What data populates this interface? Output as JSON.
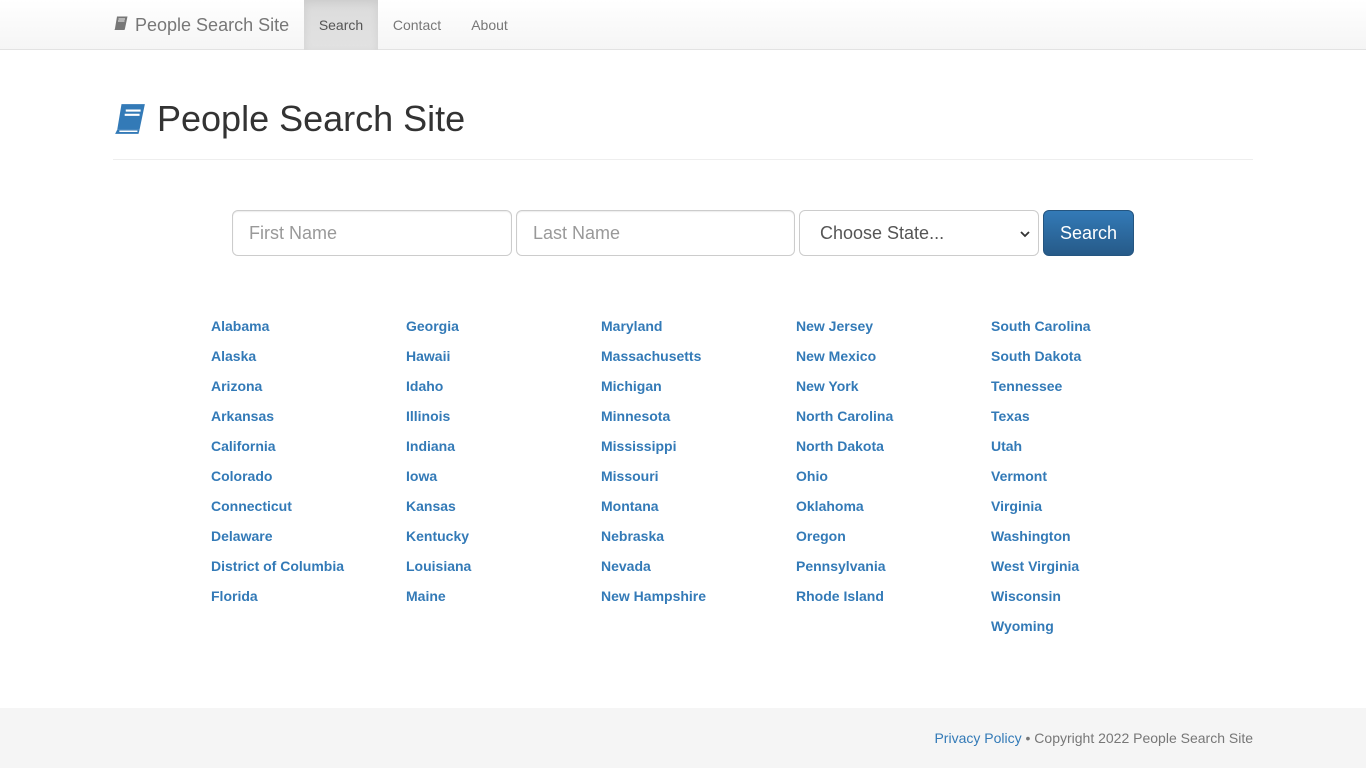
{
  "navbar": {
    "brand": "People Search Site",
    "items": [
      {
        "label": "Search",
        "active": true
      },
      {
        "label": "Contact",
        "active": false
      },
      {
        "label": "About",
        "active": false
      }
    ]
  },
  "header": {
    "title": "People Search Site",
    "icon": "book-icon"
  },
  "search_form": {
    "first_name_placeholder": "First Name",
    "last_name_placeholder": "Last Name",
    "state_select_value": "Choose State...",
    "search_button_label": "Search"
  },
  "states": {
    "columns": [
      [
        "Alabama",
        "Alaska",
        "Arizona",
        "Arkansas",
        "California",
        "Colorado",
        "Connecticut",
        "Delaware",
        "District of Columbia",
        "Florida"
      ],
      [
        "Georgia",
        "Hawaii",
        "Idaho",
        "Illinois",
        "Indiana",
        "Iowa",
        "Kansas",
        "Kentucky",
        "Louisiana",
        "Maine"
      ],
      [
        "Maryland",
        "Massachusetts",
        "Michigan",
        "Minnesota",
        "Mississippi",
        "Missouri",
        "Montana",
        "Nebraska",
        "Nevada",
        "New Hampshire"
      ],
      [
        "New Jersey",
        "New Mexico",
        "New York",
        "North Carolina",
        "North Dakota",
        "Ohio",
        "Oklahoma",
        "Oregon",
        "Pennsylvania",
        "Rhode Island"
      ],
      [
        "South Carolina",
        "South Dakota",
        "Tennessee",
        "Texas",
        "Utah",
        "Vermont",
        "Virginia",
        "Washington",
        "West Virginia",
        "Wisconsin",
        "Wyoming"
      ]
    ]
  },
  "footer": {
    "privacy_link": "Privacy Policy",
    "separator": " • ",
    "copyright": "Copyright 2022 People Search Site"
  },
  "colors": {
    "link": "#337ab7",
    "button": "#337ab7",
    "navbar_active": "#e2e2e2",
    "footer_bg": "#f5f5f5"
  }
}
